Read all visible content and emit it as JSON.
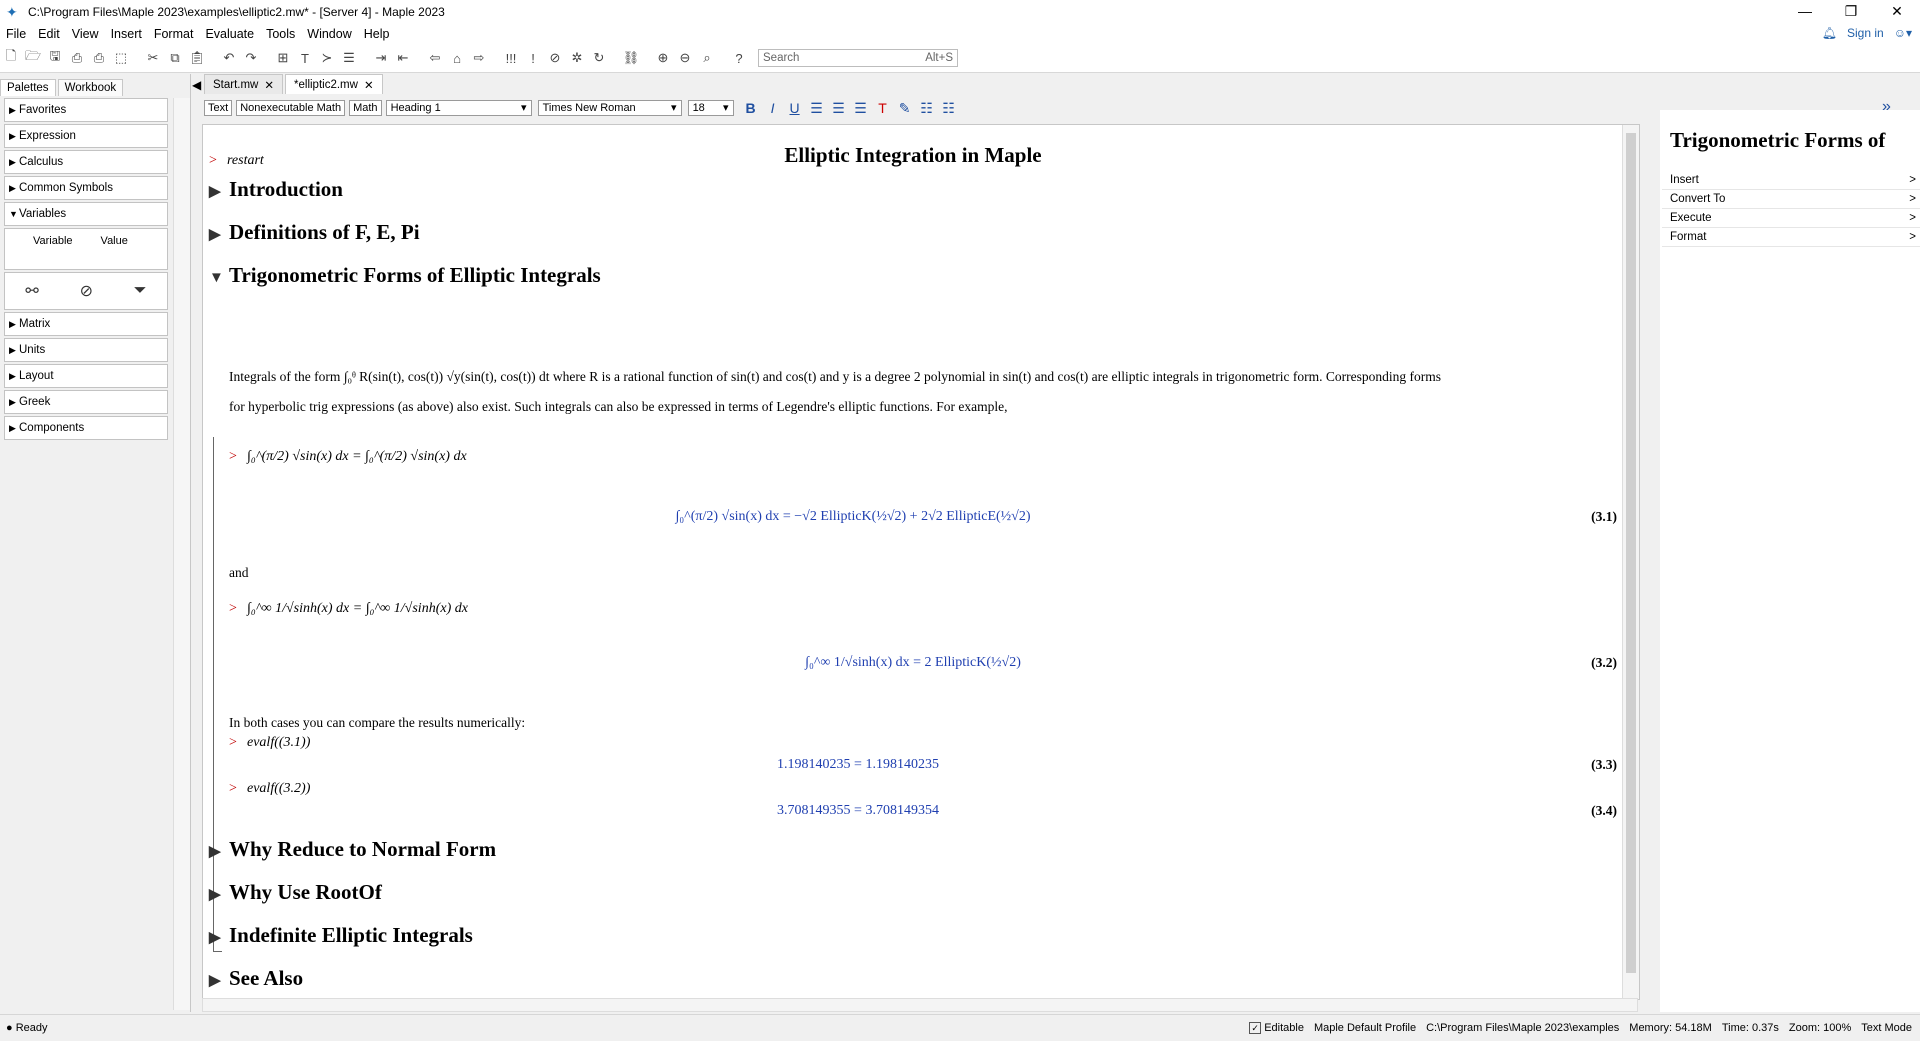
{
  "window": {
    "title": "C:\\Program Files\\Maple 2023\\examples\\elliptic2.mw* - [Server 4] - Maple 2023",
    "sign_in": "Sign in"
  },
  "menu": [
    "File",
    "Edit",
    "View",
    "Insert",
    "Format",
    "Evaluate",
    "Tools",
    "Window",
    "Help"
  ],
  "search": {
    "placeholder": "Search",
    "shortcut": "Alt+S"
  },
  "left_panel": {
    "tabs": [
      "Palettes",
      "Workbook"
    ],
    "palettes_top": [
      "Favorites",
      "Expression",
      "Calculus",
      "Common Symbols",
      "Variables"
    ],
    "variables_headers": [
      "Variable",
      "Value"
    ],
    "palettes_bottom": [
      "Matrix",
      "Units",
      "Layout",
      "Greek",
      "Components"
    ]
  },
  "doc_tabs": [
    "Start.mw",
    "*elliptic2.mw"
  ],
  "context_bar": {
    "mode_buttons": [
      "Text",
      "Nonexecutable Math",
      "Math"
    ],
    "style": "Heading 1",
    "font": "Times New Roman",
    "size": "18"
  },
  "document": {
    "title": "Elliptic Integration in Maple",
    "restart": "restart",
    "sections": {
      "intro": "Introduction",
      "defs": "Definitions of F, E, Pi",
      "trig": "Trigonometric Forms of Elliptic Integrals",
      "why_reduce": "Why Reduce to Normal Form",
      "why_rootof": "Why Use RootOf",
      "indefinite": "Indefinite Elliptic Integrals",
      "see_also": "See Also"
    },
    "para1_line1": "Integrals of the form ∫₀ᶿ R(sin(t), cos(t)) √y(sin(t), cos(t)) dt where R is a rational function of sin(t) and cos(t) and y is a degree 2 polynomial in sin(t) and cos(t) are elliptic integrals in trigonometric form. Corresponding forms",
    "para1_line2": "for hyperbolic trig expressions (as above) also exist.  Such integrals  can also be expressed in terms of Legendre's elliptic functions. For example,",
    "input1": "∫₀^(π/2) √sin(x) dx = ∫₀^(π/2) √sin(x) dx",
    "output1": "∫₀^(π/2) √sin(x) dx = −√2 EllipticK(½√2) + 2√2 EllipticE(½√2)",
    "label1": "(3.1)",
    "and": "and",
    "input2": "∫₀^∞ 1/√sinh(x) dx = ∫₀^∞ 1/√sinh(x) dx",
    "output2": "∫₀^∞ 1/√sinh(x) dx = 2 EllipticK(½√2)",
    "label2": "(3.2)",
    "compare": "In both cases you can compare the results numerically:",
    "evalf1": "evalf((3.1))",
    "result3": "1.198140235 = 1.198140235",
    "label3": "(3.3)",
    "evalf2": "evalf((3.2))",
    "result4": "3.708149355 = 3.708149354",
    "label4": "(3.4)"
  },
  "right_panel": {
    "title": "Trigonometric Forms of",
    "items": [
      "Insert",
      "Convert To",
      "Execute",
      "Format"
    ]
  },
  "status": {
    "ready": "Ready",
    "editable": "Editable",
    "profile": "Maple Default Profile",
    "path": "C:\\Program Files\\Maple 2023\\examples",
    "memory": "Memory: 54.18M",
    "time": "Time: 0.37s",
    "zoom": "Zoom: 100%",
    "mode": "Text Mode"
  }
}
